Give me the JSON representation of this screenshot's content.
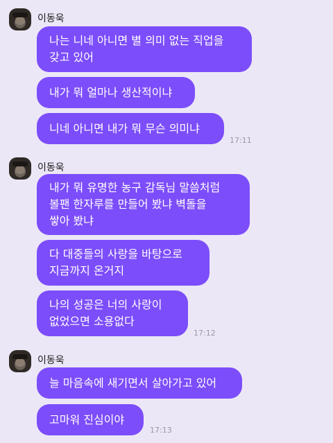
{
  "messages": [
    {
      "sender": "이동욱",
      "bubbles": [
        "나는 니네 아니면 별 의미 없는 직업을\n갖고 있어",
        "내가 뭐 얼마나 생산적이냐",
        "니네 아니면 내가 뭐 무슨 의미냐"
      ],
      "time": "17:11"
    },
    {
      "sender": "이동욱",
      "bubbles": [
        "내가 뭐 유명한 농구 감독님 말씀처럼\n볼팬 한자루를 만들어 봤냐 벽돌을\n쌓아 봤냐",
        "다 대중들의 사랑을 바탕으로\n지금까지 온거지",
        "나의 성공은 너의 사랑이\n없었으면 소용없다"
      ],
      "time": "17:12"
    },
    {
      "sender": "이동욱",
      "bubbles": [
        "늘 마음속에 새기면서 살아가고 있어",
        "고마워 진심이야"
      ],
      "time": "17:13"
    }
  ],
  "colors": {
    "background": "#ece7f6",
    "bubble": "#7c4dfa",
    "bubble_text": "#ffffff",
    "time": "#9b97a3"
  }
}
